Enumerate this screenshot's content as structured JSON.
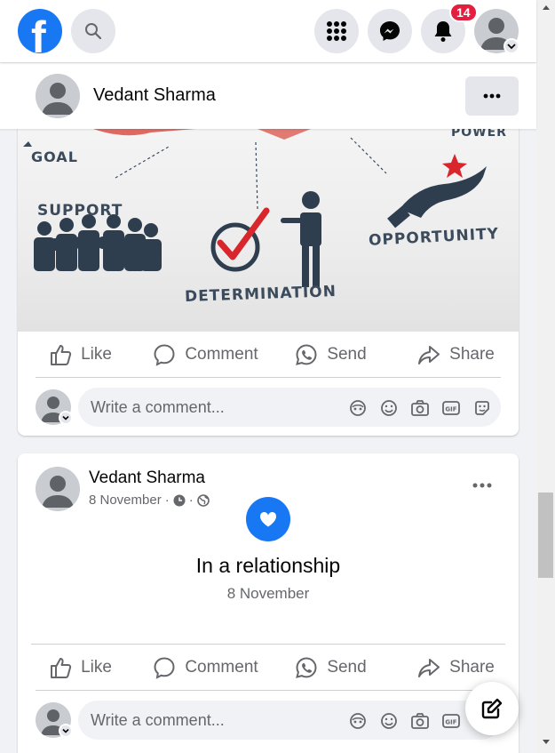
{
  "topbar": {
    "logo_letter": "f",
    "notification_count": "14"
  },
  "icons": {
    "logo": "facebook-logo-icon",
    "search": "search-icon",
    "menu": "grid-menu-icon",
    "messenger": "messenger-icon",
    "notifications": "bell-icon",
    "profile": "profile-avatar-icon"
  },
  "colors": {
    "brand": "#1877f2",
    "badge": "#e41e3f",
    "background": "#f0f2f5",
    "secondary_text": "#65676b"
  },
  "post1": {
    "author": "Vedant Sharma",
    "image_words": {
      "goal": "GOAL",
      "support": "SUPPORT",
      "determination": "DETERMINATION",
      "opportunity": "OPPORTUNITY",
      "power": "POWER"
    },
    "actions": {
      "like": "Like",
      "comment": "Comment",
      "send": "Send",
      "share": "Share"
    },
    "comment_placeholder": "Write a comment..."
  },
  "post2": {
    "author": "Vedant Sharma",
    "date": "8 November",
    "meta_separator": "·",
    "event_title": "In a relationship",
    "event_date": "8 November",
    "actions": {
      "like": "Like",
      "comment": "Comment",
      "send": "Send",
      "share": "Share"
    },
    "comment_placeholder": "Write a comment..."
  }
}
